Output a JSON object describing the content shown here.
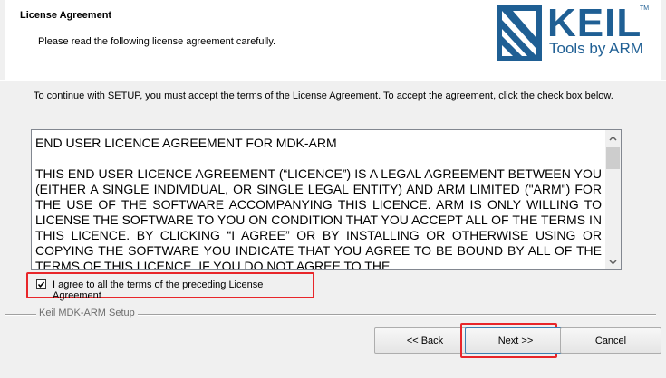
{
  "header": {
    "title": "License Agreement",
    "subtitle": "Please read the following license agreement carefully.",
    "logo": {
      "wordmark": "KEIL",
      "trademark": "TM",
      "tagline": "Tools by ARM"
    }
  },
  "instructions": "To continue with SETUP, you must accept the terms of the License Agreement. To accept the agreement, click the check box below.",
  "license": {
    "heading": "END USER LICENCE AGREEMENT FOR MDK-ARM",
    "body": "THIS END USER LICENCE AGREEMENT (“LICENCE”) IS A LEGAL AGREEMENT BETWEEN YOU (EITHER A SINGLE INDIVIDUAL, OR SINGLE LEGAL ENTITY) AND ARM LIMITED (\"ARM\") FOR THE USE OF THE SOFTWARE ACCOMPANYING THIS LICENCE. ARM IS ONLY WILLING TO LICENSE THE SOFTWARE TO YOU ON CONDITION THAT YOU ACCEPT ALL OF THE TERMS IN THIS LICENCE. BY CLICKING “I AGREE” OR BY INSTALLING OR OTHERWISE USING OR COPYING THE SOFTWARE YOU INDICATE THAT YOU AGREE TO BE BOUND BY ALL OF THE TERMS OF THIS LICENCE. IF YOU DO NOT AGREE TO THE"
  },
  "agree": {
    "label": "I agree to all the terms of the preceding License Agreement",
    "checked": true
  },
  "footer": {
    "group_label": "Keil MDK-ARM Setup"
  },
  "buttons": {
    "back": "<< Back",
    "next": "Next >>",
    "cancel": "Cancel"
  },
  "colors": {
    "brand": "#1f5f94",
    "highlight": "#e8262a"
  }
}
